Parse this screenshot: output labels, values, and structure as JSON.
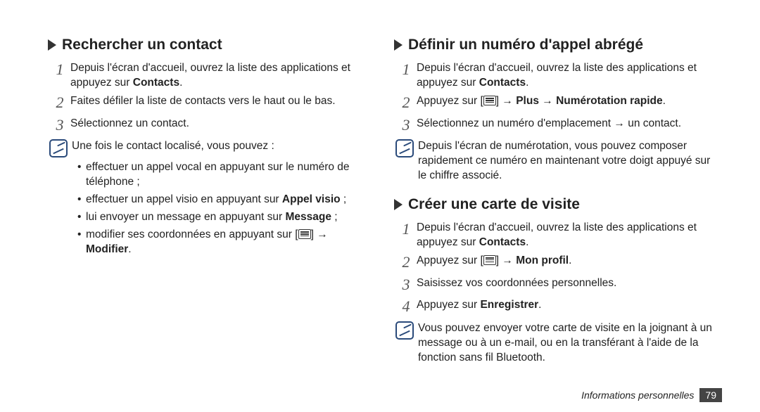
{
  "left": {
    "heading": "Rechercher un contact",
    "steps": [
      {
        "pre": "Depuis l'écran d'accueil, ouvrez la liste des applications et appuyez sur ",
        "bold": "Contacts",
        "post": "."
      },
      {
        "pre": "Faites défiler la liste de contacts vers le haut ou le bas."
      },
      {
        "pre": "Sélectionnez un contact."
      }
    ],
    "noteIntro": "Une fois le contact localisé, vous pouvez :",
    "bullet1": "effectuer un appel vocal en appuyant sur le numéro de téléphone ;",
    "bullet2a": "effectuer un appel visio en appuyant sur ",
    "bullet2b": "Appel visio",
    "bullet2c": " ;",
    "bullet3a": "lui envoyer un message en appuyant sur ",
    "bullet3b": "Message",
    "bullet3c": " ;",
    "bullet4a": "modifier ses coordonnées en appuyant sur [",
    "bullet4b": "] → ",
    "bullet4c": "Modifier",
    "bullet4d": "."
  },
  "right1": {
    "heading": "Définir un numéro d'appel abrégé",
    "step1a": "Depuis l'écran d'accueil, ouvrez la liste des applications et appuyez sur ",
    "step1b": "Contacts",
    "step1c": ".",
    "step2a": "Appuyez sur [",
    "step2b": "] → ",
    "step2c": "Plus",
    "step2d": " → ",
    "step2e": "Numérotation rapide",
    "step2f": ".",
    "step3": "Sélectionnez un numéro d'emplacement → un contact.",
    "note": "Depuis l'écran de numérotation, vous pouvez composer rapidement ce numéro en maintenant votre doigt appuyé sur le chiffre associé."
  },
  "right2": {
    "heading": "Créer une carte de visite",
    "step1a": "Depuis l'écran d'accueil, ouvrez la liste des applications et appuyez sur ",
    "step1b": "Contacts",
    "step1c": ".",
    "step2a": "Appuyez sur [",
    "step2b": "] → ",
    "step2c": "Mon profil",
    "step2d": ".",
    "step3": "Saisissez vos coordonnées personnelles.",
    "step4a": "Appuyez sur ",
    "step4b": "Enregistrer",
    "step4c": ".",
    "note": "Vous pouvez envoyer votre carte de visite en la joignant à un message ou à un e-mail, ou en la transférant à l'aide de la fonction sans fil Bluetooth."
  },
  "footer": {
    "label": "Informations personnelles",
    "page": "79"
  }
}
